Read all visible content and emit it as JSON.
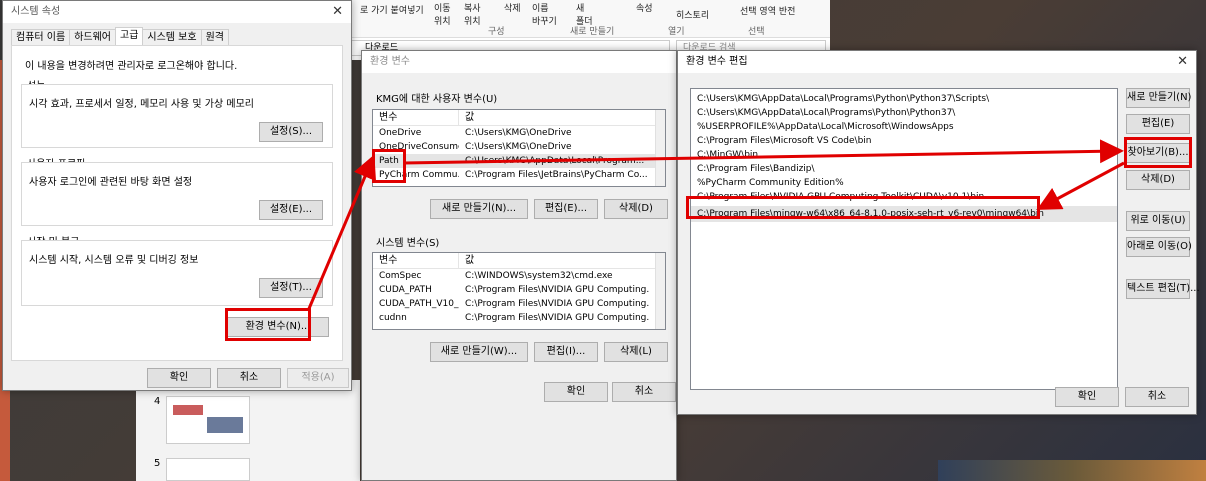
{
  "ribbon": {
    "copy_path": "로 가기 붙여넣기",
    "move_to": "이동\n위치",
    "copy_to": "복사\n위치",
    "delete": "삭제",
    "rename": "이름\n바꾸기",
    "new_folder": "새\n폴더",
    "group_organize": "구성",
    "group_new": "새로 만들기",
    "group_open": "열기",
    "history": "히스토리",
    "select_invert": "선택 영역 반전",
    "group_select": "선택",
    "attr": "속성",
    "downloads_tab": "다운로드",
    "downloads_search": "다운로드 검색"
  },
  "sysprops": {
    "title": "시스템 속성",
    "tabs": [
      "컴퓨터 이름",
      "하드웨어",
      "고급",
      "시스템 보호",
      "원격"
    ],
    "admin_note": "이 내용을 변경하려면 관리자로 로그온해야 합니다.",
    "perf_title": "성능",
    "perf_desc": "시각 효과, 프로세서 일정, 메모리 사용 및 가상 메모리",
    "perf_btn": "설정(S)...",
    "profile_title": "사용자 프로필",
    "profile_desc": "사용자 로그인에 관련된 바탕 화면 설정",
    "profile_btn": "설정(E)...",
    "startup_title": "시작 및 복구",
    "startup_desc": "시스템 시작, 시스템 오류 및 디버깅 정보",
    "startup_btn": "설정(T)...",
    "envvars_btn": "환경 변수(N)...",
    "ok": "확인",
    "cancel": "취소",
    "apply": "적용(A)"
  },
  "envvars": {
    "title": "환경 변수",
    "user_group": "KMG에 대한 사용자 변수(U)",
    "col_var": "변수",
    "col_val": "값",
    "user_rows": [
      {
        "name": "OneDrive",
        "value": "C:\\Users\\KMG\\OneDrive"
      },
      {
        "name": "OneDriveConsumer",
        "value": "C:\\Users\\KMG\\OneDrive"
      },
      {
        "name": "Path",
        "value": "C:\\Users\\KMG\\AppData\\Local\\Program..."
      },
      {
        "name": "PyCharm Commu...",
        "value": "C:\\Program Files\\JetBrains\\PyCharm Co..."
      }
    ],
    "user_new": "새로 만들기(N)...",
    "user_edit": "편집(E)...",
    "user_delete": "삭제(D)",
    "sys_group": "시스템 변수(S)",
    "sys_rows": [
      {
        "name": "ComSpec",
        "value": "C:\\WINDOWS\\system32\\cmd.exe"
      },
      {
        "name": "CUDA_PATH",
        "value": "C:\\Program Files\\NVIDIA GPU Computing..."
      },
      {
        "name": "CUDA_PATH_V10_1",
        "value": "C:\\Program Files\\NVIDIA GPU Computing..."
      },
      {
        "name": "cudnn",
        "value": "C:\\Program Files\\NVIDIA GPU Computing..."
      }
    ],
    "sys_new": "새로 만들기(W)...",
    "sys_edit": "편집(I)...",
    "sys_delete": "삭제(L)",
    "ok": "확인",
    "cancel": "취소"
  },
  "editenv": {
    "title": "환경 변수 편집",
    "entries": [
      "C:\\Users\\KMG\\AppData\\Local\\Programs\\Python\\Python37\\Scripts\\",
      "C:\\Users\\KMG\\AppData\\Local\\Programs\\Python\\Python37\\",
      "%USERPROFILE%\\AppData\\Local\\Microsoft\\WindowsApps",
      "C:\\Program Files\\Microsoft VS Code\\bin",
      "C:\\MinGW\\bin",
      "C:\\Program Files\\Bandizip\\",
      "%PyCharm Community Edition%",
      "C:\\Program Files\\NVIDIA GPU Computing Toolkit\\CUDA\\v10.1\\bin",
      "C:\\Program Files\\mingw-w64\\x86_64-8.1.0-posix-seh-rt_v6-rev0\\mingw64\\bin"
    ],
    "btn_new": "새로 만들기(N)",
    "btn_edit": "편집(E)",
    "btn_browse": "찾아보기(B)...",
    "btn_delete": "삭제(D)",
    "btn_up": "위로 이동(U)",
    "btn_down": "아래로 이동(O)",
    "btn_text": "텍스트 편집(T)...",
    "ok": "확인",
    "cancel": "취소"
  },
  "slides": {
    "num4": "4",
    "num5": "5"
  },
  "colors": {
    "highlight": "#e00000",
    "desktop": "#2b2b2b"
  }
}
